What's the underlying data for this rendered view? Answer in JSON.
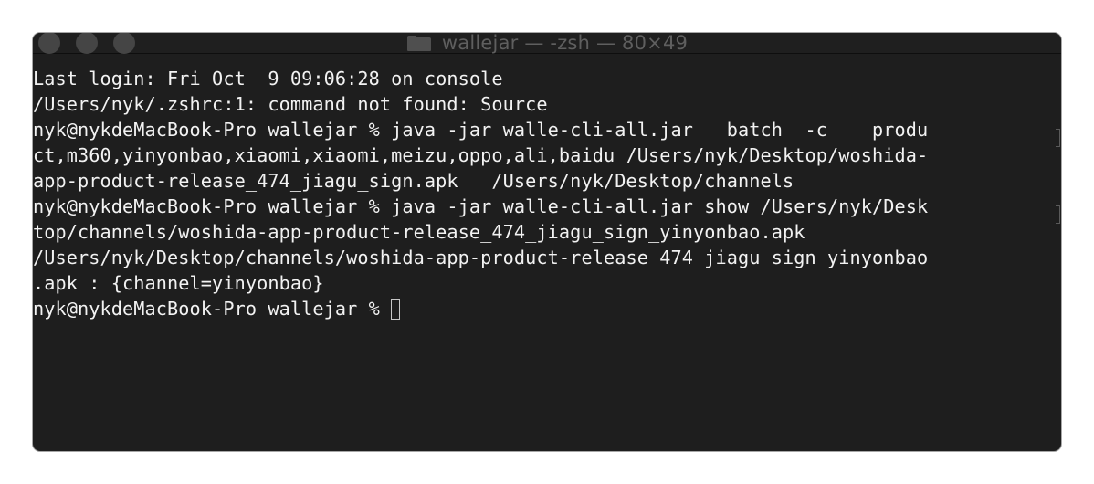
{
  "window": {
    "title": "wallejar — -zsh — 80×49",
    "title_icon": "folder-icon",
    "background": "#1e1e1e",
    "text_color": "#f2f2f2"
  },
  "terminal": {
    "lines": [
      "Last login: Fri Oct  9 09:06:28 on console",
      "/Users/nyk/.zshrc:1: command not found: Source",
      "nyk@nykdeMacBook-Pro wallejar % java -jar walle-cli-all.jar   batch  -c    produ",
      "ct,m360,yinyonbao,xiaomi,xiaomi,meizu,oppo,ali,baidu /Users/nyk/Desktop/woshida-",
      "app-product-release_474_jiagu_sign.apk   /Users/nyk/Desktop/channels",
      "nyk@nykdeMacBook-Pro wallejar % java -jar walle-cli-all.jar show /Users/nyk/Desk",
      "top/channels/woshida-app-product-release_474_jiagu_sign_yinyonbao.apk",
      "/Users/nyk/Desktop/channels/woshida-app-product-release_474_jiagu_sign_yinyonbao",
      ".apk : {channel=yinyonbao}"
    ],
    "prompt": "nyk@nykdeMacBook-Pro wallejar % "
  }
}
